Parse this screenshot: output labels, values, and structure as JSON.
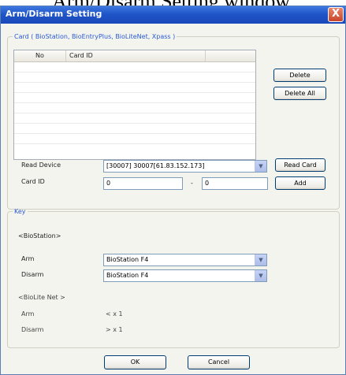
{
  "top_caption": "Arm/Disarm Setting window.",
  "window": {
    "title": "Arm/Disarm Setting",
    "close_glyph": "X"
  },
  "card_group": {
    "legend": "Card ( BioStation, BioEntryPlus, BioLiteNet, Xpass )",
    "table": {
      "columns": [
        "No",
        "Card ID"
      ],
      "rows": []
    },
    "delete_label": "Delete",
    "delete_all_label": "Delete All",
    "read_device_label": "Read Device",
    "read_device_value": "[30007] 30007[61.83.152.173]",
    "read_card_label": "Read Card",
    "card_id_label": "Card ID",
    "card_id_from": "0",
    "card_id_dash": "-",
    "card_id_to": "0",
    "add_label": "Add"
  },
  "key_group": {
    "legend": "Key",
    "biostation_header": "<BioStation>",
    "arm_label": "Arm",
    "arm_value": "BioStation F4",
    "disarm_label": "Disarm",
    "disarm_value": "BioStation F4",
    "biolite_header": "<BioLite Net >",
    "biolite_arm_label": "Arm",
    "biolite_arm_value": "< x 1",
    "biolite_disarm_label": "Disarm",
    "biolite_disarm_value": "> x 1"
  },
  "footer": {
    "ok_label": "OK",
    "cancel_label": "Cancel"
  },
  "icons": {
    "dropdown_arrow": "chevron-down-icon",
    "close": "close-icon"
  }
}
